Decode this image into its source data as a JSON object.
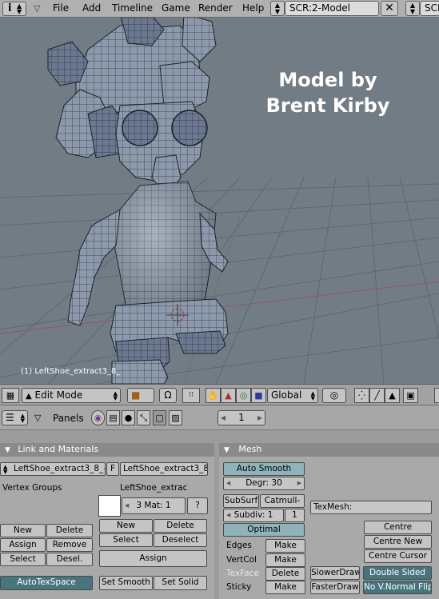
{
  "topbar": {
    "menu": [
      "File",
      "Add",
      "Timeline",
      "Game",
      "Render",
      "Help"
    ],
    "screen": "SCR:2-Model",
    "screen_right": "SCE"
  },
  "viewport": {
    "credit_line1": "Model by",
    "credit_line2": "Brent Kirby",
    "object_label": "(1) LeftShoe_extract3_8_"
  },
  "vp_header": {
    "mode": "Edit Mode",
    "orientation": "Global"
  },
  "buttons_header": {
    "panels_label": "Panels",
    "frame_value": "1"
  },
  "link_materials": {
    "title": "Link and Materials",
    "mesh_name": "LeftShoe_extract3_8_-",
    "f_label": "F",
    "object_name": "LeftShoe_extract3_8_",
    "vertex_groups_label": "Vertex Groups",
    "material_object": "LeftShoe_extrac",
    "mat_value": "3 Mat: 1",
    "question": "?",
    "vg_new": "New",
    "vg_delete": "Delete",
    "vg_assign": "Assign",
    "vg_remove": "Remove",
    "vg_select": "Select",
    "vg_desel": "Desel.",
    "mat_new": "New",
    "mat_delete": "Delete",
    "mat_select": "Select",
    "mat_deselect": "Deselect",
    "mat_assign": "Assign",
    "autotexspace": "AutoTexSpace",
    "set_smooth": "Set Smooth",
    "set_solid": "Set Solid"
  },
  "mesh": {
    "title": "Mesh",
    "auto_smooth": "Auto Smooth",
    "degr": "Degr: 30",
    "subsurf": "SubSurf",
    "catmull": "Catmull-",
    "subdiv": "Subdiv: 1",
    "subdiv_r": "1",
    "optimal": "Optimal",
    "texmesh": "TexMesh:",
    "edges": "Edges",
    "vertcol": "VertCol",
    "texface": "TexFace",
    "sticky": "Sticky",
    "make1": "Make",
    "make2": "Make",
    "delete": "Delete",
    "make3": "Make",
    "centre": "Centre",
    "centre_new": "Centre New",
    "centre_cursor": "Centre Cursor",
    "slower_draw": "SlowerDraw",
    "faster_draw": "FasterDraw",
    "double_sided": "Double Sided",
    "no_vnormal_flip": "No V.Normal Flip"
  }
}
